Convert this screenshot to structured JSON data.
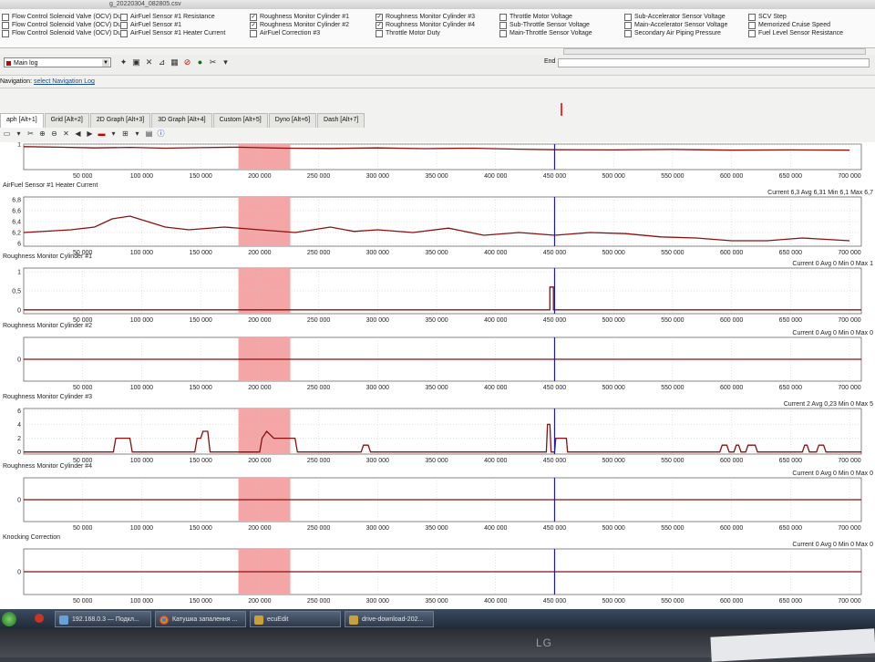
{
  "window": {
    "title": "g_20220304_082805.csv"
  },
  "params": {
    "col1": [
      {
        "label": "Flow Control Solenoid Valve (OCV) Duty",
        "checked": false
      },
      {
        "label": "Flow Control Solenoid Valve (OCV) Duty",
        "checked": false
      },
      {
        "label": "Flow Control Solenoid Valve (OCV) Duty",
        "checked": false
      }
    ],
    "col2": [
      {
        "label": "AirFuel Sensor #1 Resistance",
        "checked": false
      },
      {
        "label": "AirFuel Sensor #1",
        "checked": false
      },
      {
        "label": "AirFuel Sensor #1 Heater Current",
        "checked": false
      }
    ],
    "col3": [
      {
        "label": "Roughness Monitor Cylinder #1",
        "checked": true
      },
      {
        "label": "Roughness Monitor Cylinder #2",
        "checked": true
      },
      {
        "label": "AirFuel Correction #3",
        "checked": false
      }
    ],
    "col4": [
      {
        "label": "Roughness Monitor Cylinder #3",
        "checked": true
      },
      {
        "label": "Roughness Monitor Cylinder #4",
        "checked": true
      },
      {
        "label": "Throttle Motor Duty",
        "checked": false
      }
    ],
    "col5": [
      {
        "label": "Throttle Motor Voltage",
        "checked": false
      },
      {
        "label": "Sub-Throttle Sensor Voltage",
        "checked": false
      },
      {
        "label": "Main-Throttle Sensor Voltage",
        "checked": false
      }
    ],
    "col6": [
      {
        "label": "Sub-Accelerator Sensor Voltage",
        "checked": false
      },
      {
        "label": "Main-Accelerator Sensor Voltage",
        "checked": false
      },
      {
        "label": "Secondary Air Piping Pressure",
        "checked": false
      }
    ],
    "col7": [
      {
        "label": "SCV Step",
        "checked": false
      },
      {
        "label": "Memorized Cruise Speed",
        "checked": false
      },
      {
        "label": "Fuel Level Sensor Resistance",
        "checked": false
      }
    ]
  },
  "toolbar": {
    "log_select": "Main log",
    "end_label": "End"
  },
  "navigation": {
    "label": "Navigation:",
    "link": "select Navigation Log"
  },
  "tabs": [
    {
      "label": "aph [Alt+1]",
      "active": true
    },
    {
      "label": "Grid [Alt+2]",
      "active": false
    },
    {
      "label": "2D Graph [Alt+3]",
      "active": false
    },
    {
      "label": "3D Graph [Alt+4]",
      "active": false
    },
    {
      "label": "Custom [Alt+5]",
      "active": false
    },
    {
      "label": "Dyno [Alt+6]",
      "active": false
    },
    {
      "label": "Dash [Alt+7]",
      "active": false
    }
  ],
  "colors": {
    "trace": "#8a1010",
    "highlight": "#f4a6a6",
    "cursor": "#1a1aaa",
    "grid": "#c8c8c8"
  },
  "chart_data": {
    "type": "line",
    "x_ticks": [
      50000,
      100000,
      150000,
      200000,
      250000,
      300000,
      350000,
      400000,
      450000,
      500000,
      550000,
      600000,
      650000,
      700000
    ],
    "x_tick_labels": [
      "50 000",
      "100 000",
      "150 000",
      "200 000",
      "250 000",
      "300 000",
      "350 000",
      "400 000",
      "450 000",
      "500 000",
      "550 000",
      "600 000",
      "650 000",
      "700 000"
    ],
    "xlim": [
      0,
      710000
    ],
    "highlight_range": [
      182000,
      226000
    ],
    "cursor_x": 450000,
    "grid": true,
    "panels": [
      {
        "title": "",
        "stats": "",
        "ylim": [
          0,
          1
        ],
        "y_ticks": [
          1
        ],
        "y_tick_labels": [
          "1"
        ],
        "points": [
          [
            0,
            0.9
          ],
          [
            30000,
            0.88
          ],
          [
            60000,
            0.85
          ],
          [
            90000,
            0.87
          ],
          [
            120000,
            0.84
          ],
          [
            150000,
            0.86
          ],
          [
            180000,
            0.88
          ],
          [
            220000,
            0.84
          ],
          [
            260000,
            0.83
          ],
          [
            300000,
            0.85
          ],
          [
            340000,
            0.82
          ],
          [
            380000,
            0.84
          ],
          [
            420000,
            0.8
          ],
          [
            450000,
            0.78
          ],
          [
            500000,
            0.77
          ],
          [
            550000,
            0.79
          ],
          [
            600000,
            0.76
          ],
          [
            650000,
            0.77
          ],
          [
            700000,
            0.76
          ]
        ]
      },
      {
        "title": "AirFuel Sensor #1 Heater Current",
        "stats": "Current 6,3 Avg 6,31 Min 6,1 Max 6,7",
        "ylim": [
          5.95,
          6.85
        ],
        "y_ticks": [
          6,
          6.2,
          6.4,
          6.6,
          6.8
        ],
        "y_tick_labels": [
          "6",
          "6,2",
          "6,4",
          "6,6",
          "6,8"
        ],
        "points": [
          [
            0,
            6.2
          ],
          [
            40000,
            6.25
          ],
          [
            60000,
            6.3
          ],
          [
            75000,
            6.45
          ],
          [
            90000,
            6.5
          ],
          [
            105000,
            6.4
          ],
          [
            120000,
            6.3
          ],
          [
            140000,
            6.25
          ],
          [
            170000,
            6.3
          ],
          [
            200000,
            6.25
          ],
          [
            230000,
            6.2
          ],
          [
            260000,
            6.3
          ],
          [
            280000,
            6.22
          ],
          [
            300000,
            6.25
          ],
          [
            330000,
            6.2
          ],
          [
            360000,
            6.28
          ],
          [
            390000,
            6.15
          ],
          [
            420000,
            6.2
          ],
          [
            450000,
            6.15
          ],
          [
            480000,
            6.2
          ],
          [
            510000,
            6.18
          ],
          [
            540000,
            6.12
          ],
          [
            570000,
            6.1
          ],
          [
            600000,
            6.05
          ],
          [
            630000,
            6.05
          ],
          [
            660000,
            6.1
          ],
          [
            700000,
            6.05
          ]
        ]
      },
      {
        "title": "Roughness Monitor Cylinder #1",
        "stats": "Current 0 Avg 0 Min 0 Max 1",
        "ylim": [
          -0.1,
          1.1
        ],
        "y_ticks": [
          0,
          0.5,
          1
        ],
        "y_tick_labels": [
          "0",
          "0,5",
          "1"
        ],
        "points": [
          [
            0,
            0
          ],
          [
            446000,
            0
          ],
          [
            446000,
            0.6
          ],
          [
            449000,
            0.6
          ],
          [
            449000,
            0
          ],
          [
            710000,
            0
          ]
        ]
      },
      {
        "title": "Roughness Monitor Cylinder #2",
        "stats": "Current 0 Avg 0 Min 0 Max 0",
        "ylim": [
          -1,
          1
        ],
        "y_ticks": [
          0
        ],
        "y_tick_labels": [
          "0"
        ],
        "points": [
          [
            0,
            0
          ],
          [
            710000,
            0
          ]
        ]
      },
      {
        "title": "Roughness Monitor Cylinder #3",
        "stats": "Current 2 Avg 0,23 Min 0 Max 5",
        "ylim": [
          -0.3,
          6.3
        ],
        "y_ticks": [
          0,
          2,
          4,
          6
        ],
        "y_tick_labels": [
          "0",
          "2",
          "4",
          "6"
        ],
        "points": [
          [
            0,
            0
          ],
          [
            76000,
            0
          ],
          [
            78000,
            2
          ],
          [
            90000,
            2
          ],
          [
            92000,
            0
          ],
          [
            145000,
            0
          ],
          [
            147000,
            2
          ],
          [
            150000,
            2
          ],
          [
            152000,
            3
          ],
          [
            156000,
            3
          ],
          [
            158000,
            0
          ],
          [
            200000,
            0
          ],
          [
            202000,
            2
          ],
          [
            206000,
            3
          ],
          [
            212000,
            2
          ],
          [
            230000,
            2
          ],
          [
            232000,
            0
          ],
          [
            286000,
            0
          ],
          [
            288000,
            1
          ],
          [
            292000,
            1
          ],
          [
            294000,
            0
          ],
          [
            443000,
            0
          ],
          [
            444000,
            4
          ],
          [
            446000,
            4
          ],
          [
            447000,
            0
          ],
          [
            450000,
            0
          ],
          [
            451000,
            2
          ],
          [
            460000,
            2
          ],
          [
            461000,
            0
          ],
          [
            590000,
            0
          ],
          [
            592000,
            1
          ],
          [
            596000,
            1
          ],
          [
            598000,
            0
          ],
          [
            602000,
            0
          ],
          [
            604000,
            1
          ],
          [
            606000,
            1
          ],
          [
            608000,
            0
          ],
          [
            612000,
            0
          ],
          [
            614000,
            1
          ],
          [
            620000,
            1
          ],
          [
            622000,
            0
          ],
          [
            660000,
            0
          ],
          [
            662000,
            1
          ],
          [
            664000,
            1
          ],
          [
            666000,
            0
          ],
          [
            672000,
            0
          ],
          [
            674000,
            1
          ],
          [
            678000,
            1
          ],
          [
            680000,
            0
          ],
          [
            710000,
            0
          ]
        ]
      },
      {
        "title": "Roughness Monitor Cylinder #4",
        "stats": "Current 0 Avg 0 Min 0 Max 0",
        "ylim": [
          -1,
          1
        ],
        "y_ticks": [
          0
        ],
        "y_tick_labels": [
          "0"
        ],
        "points": [
          [
            0,
            0
          ],
          [
            710000,
            0
          ]
        ]
      },
      {
        "title": "Knocking Correction",
        "stats": "Current 0 Avg 0 Min 0 Max 0",
        "ylim": [
          -1,
          1
        ],
        "y_ticks": [
          0
        ],
        "y_tick_labels": [
          "0"
        ],
        "points": [
          [
            0,
            0
          ],
          [
            710000,
            0
          ]
        ]
      }
    ]
  },
  "taskbar": {
    "buttons": [
      {
        "label": "192.168.0.3 — Подкл...",
        "icon": "network-icon"
      },
      {
        "label": "Катушка запалення ...",
        "icon": "chrome-icon"
      },
      {
        "label": "ecuEdit",
        "icon": "app-icon"
      },
      {
        "label": "drive-download-202...",
        "icon": "folder-icon"
      }
    ]
  },
  "monitor": {
    "brand": "LG"
  }
}
